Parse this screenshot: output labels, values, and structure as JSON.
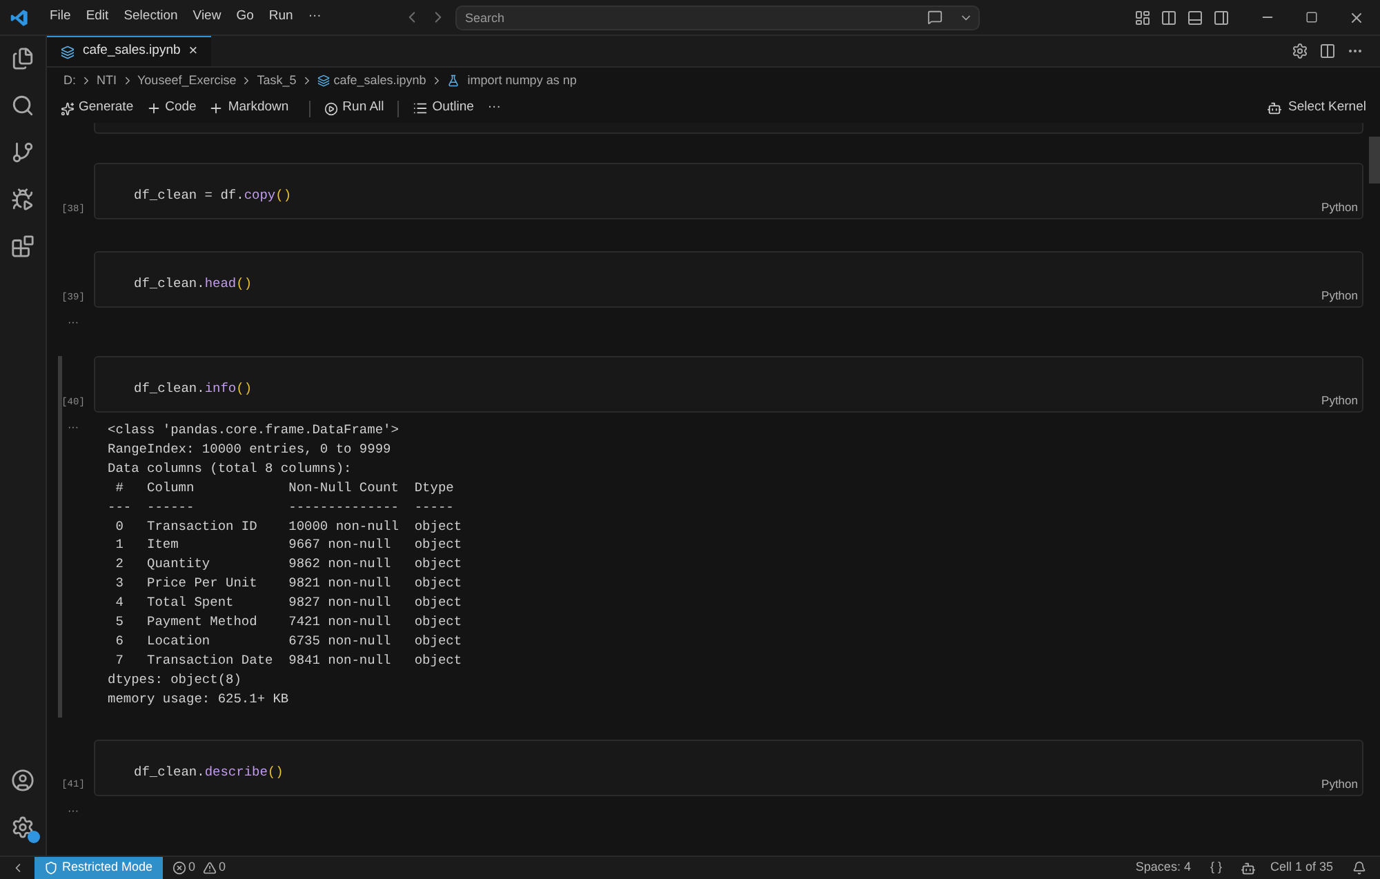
{
  "menu": [
    "File",
    "Edit",
    "Selection",
    "View",
    "Go",
    "Run",
    "···"
  ],
  "search": {
    "placeholder": "Search"
  },
  "tab": {
    "label": "cafe_sales.ipynb",
    "close": "×",
    "selected": true
  },
  "breadcrumb": [
    {
      "kind": "text",
      "label": "D:"
    },
    {
      "kind": "text",
      "label": "NTI"
    },
    {
      "kind": "text",
      "label": "Youseef_Exercise"
    },
    {
      "kind": "text",
      "label": "Task_5"
    },
    {
      "kind": "file",
      "label": "cafe_sales.ipynb"
    },
    {
      "kind": "symbol",
      "label": "import numpy as np"
    }
  ],
  "toolbar": [
    {
      "kind": "generate",
      "label": "Generate"
    },
    {
      "kind": "add",
      "label": "Code"
    },
    {
      "kind": "add",
      "label": "Markdown"
    },
    {
      "kind": "divider"
    },
    {
      "kind": "run",
      "label": "Run All"
    },
    {
      "kind": "divider"
    },
    {
      "kind": "outline",
      "label": "Outline"
    },
    {
      "kind": "more",
      "label": "···"
    }
  ],
  "kernel": "Select Kernel",
  "cells": [
    {
      "count": "[38]",
      "language": "Python",
      "selected": false,
      "code": {
        "object": "df_clean = df.",
        "method": "copy",
        "parens": "()"
      }
    },
    {
      "count": "[39]",
      "language": "Python",
      "selected": false,
      "code": {
        "object": "df_clean.",
        "method": "head",
        "parens": "()"
      },
      "output_marker": "···"
    },
    {
      "count": "[40]",
      "language": "Python",
      "selected": true,
      "code": {
        "object": "df_clean.",
        "method": "info",
        "parens": "()"
      },
      "output_marker": "···",
      "output": [
        "<class 'pandas.core.frame.DataFrame'>",
        "RangeIndex: 10000 entries, 0 to 9999",
        "Data columns (total 8 columns):",
        " #   Column            Non-Null Count  Dtype ",
        "---  ------            --------------  ----- ",
        " 0   Transaction ID    10000 non-null  object",
        " 1   Item              9667 non-null   object",
        " 2   Quantity          9862 non-null   object",
        " 3   Price Per Unit    9821 non-null   object",
        " 4   Total Spent       9827 non-null   object",
        " 5   Payment Method    7421 non-null   object",
        " 6   Location          6735 non-null   object",
        " 7   Transaction Date  9841 non-null   object",
        "dtypes: object(8)",
        "memory usage: 625.1+ KB"
      ]
    },
    {
      "count": "[41]",
      "language": "Python",
      "selected": false,
      "code": {
        "object": "df_clean.",
        "method": "describe",
        "parens": "()"
      },
      "output_marker": "···"
    }
  ],
  "status_bar": {
    "mode": "Restricted Mode",
    "errors": "0",
    "warnings": "0",
    "spaces": "Spaces: 4",
    "braces": "{ }",
    "cell": "Cell 1 of 35"
  }
}
